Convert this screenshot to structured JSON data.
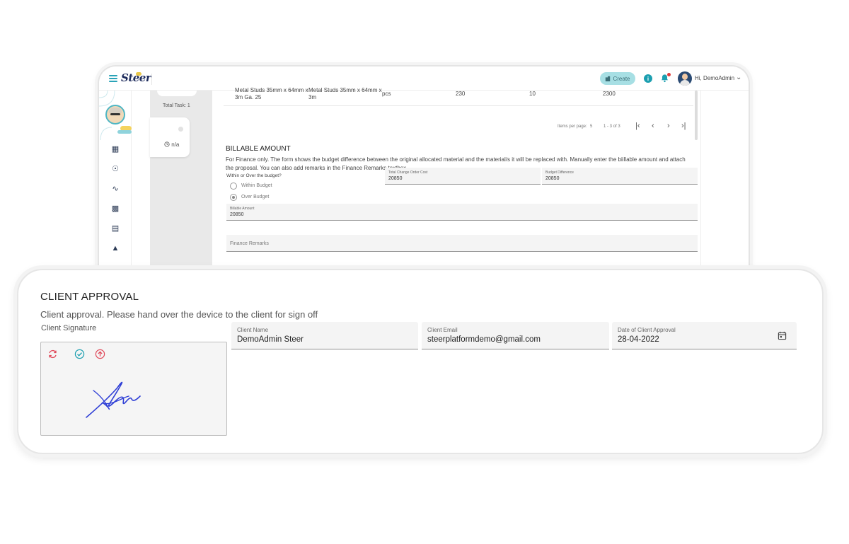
{
  "topbar": {
    "logo_text": "Steer",
    "create_label": "Create",
    "create_icon": "building-icon",
    "info_icon": "info-icon",
    "bell_icon": "bell-icon",
    "greeting": "Hi, DemoAdmin"
  },
  "task_column": {
    "total_task": "Total Task: 1",
    "task_status": "n/a"
  },
  "materials_row": {
    "original_material": "Metal Studs 35mm x 64mm x 3m Ga. 25",
    "replacement_material": "Metal Studs 35mm x 64mm x 3m",
    "unit": "pcs",
    "col_a": "230",
    "col_b": "10",
    "col_c": "2300"
  },
  "pagination": {
    "items_per_page_label": "Items per page:",
    "items_per_page_value": "5",
    "range": "1 - 3 of 3"
  },
  "billable": {
    "title": "BILLABLE AMOUNT",
    "description": "For Finance only. The form shows the budget difference between the original allocated material and the material/s it will be replaced with. Manually enter the biillable amount and attach the proposal. You can also add remarks in the Finance Remarks textbox.",
    "question": "Within or Over the budget?",
    "option_within": "Within Budget",
    "option_over": "Over Budget",
    "total_change_label": "Total Change Order Cost",
    "total_change_value": "20850",
    "budget_diff_label": "Budget Difference",
    "budget_diff_value": "20850",
    "billable_amount_label": "Billable Amount",
    "billable_amount_value": "20850",
    "finance_remarks_placeholder": "Finance Remarks"
  },
  "client_approval": {
    "title": "CLIENT APPROVAL",
    "description": "Client approval. Please hand over the device to the client for sign off",
    "signature_label": "Client Signature",
    "client_name_label": "Client Name",
    "client_name_value": "DemoAdmin Steer",
    "client_email_label": "Client Email",
    "client_email_value": "steerplatformdemo@gmail.com",
    "approval_date_label": "Date of Client Approval",
    "approval_date_value": "28-04-2022"
  },
  "colors": {
    "accent": "#1c9fb0",
    "create_bg": "#a7dfe4",
    "signature_ink": "#2f3fd6",
    "reset_tool": "#e0495a",
    "confirm_tool": "#1c9fb0"
  }
}
